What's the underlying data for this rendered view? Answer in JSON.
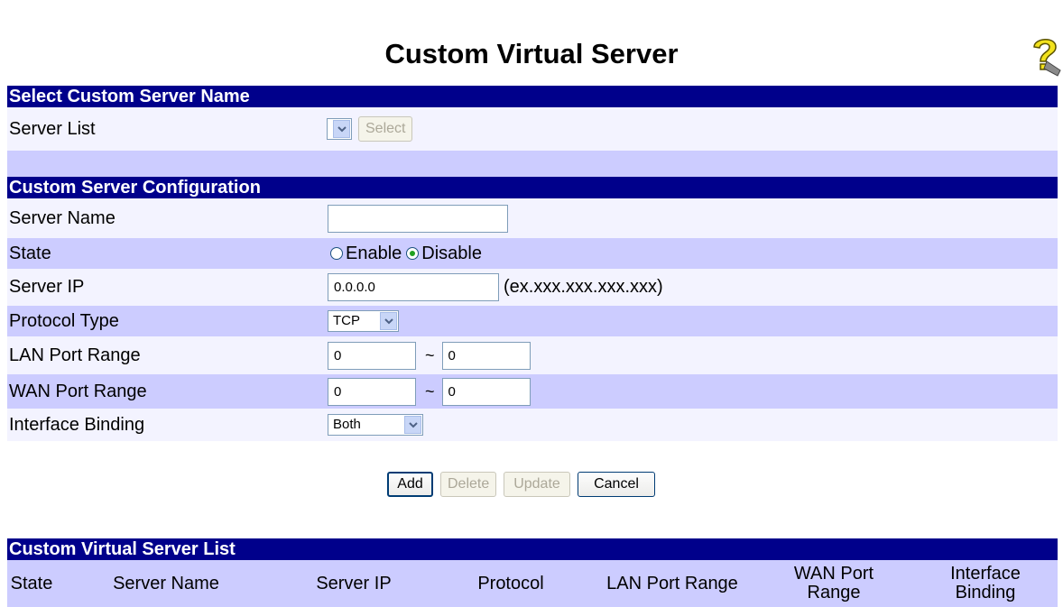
{
  "page": {
    "title": "Custom Virtual Server"
  },
  "select_section": {
    "header": "Select Custom Server Name",
    "server_list_label": "Server List",
    "server_list_value": "",
    "select_button": "Select"
  },
  "config_section": {
    "header": "Custom Server Configuration",
    "server_name_label": "Server Name",
    "server_name_value": "",
    "state_label": "State",
    "state_options": [
      "Enable",
      "Disable"
    ],
    "state_selected": "Disable",
    "server_ip_label": "Server IP",
    "server_ip_value": "0.0.0.0",
    "server_ip_hint": "(ex.xxx.xxx.xxx.xxx)",
    "protocol_label": "Protocol Type",
    "protocol_value": "TCP",
    "lan_port_label": "LAN Port Range",
    "lan_port_start": "0",
    "lan_port_end": "0",
    "wan_port_label": "WAN Port Range",
    "wan_port_start": "0",
    "wan_port_end": "0",
    "range_separator": "~",
    "interface_label": "Interface Binding",
    "interface_value": "Both"
  },
  "actions": {
    "add": "Add",
    "delete": "Delete",
    "update": "Update",
    "cancel": "Cancel"
  },
  "list_section": {
    "header": "Custom Virtual Server List",
    "columns": [
      "State",
      "Server Name",
      "Server IP",
      "Protocol",
      "LAN Port Range",
      "WAN Port Range",
      "Interface Binding"
    ]
  },
  "colors": {
    "header_bg": "#00008b",
    "row_light": "#f3f3ff",
    "row_dark": "#ccccff",
    "radio_dot": "#21a121"
  },
  "icons": {
    "help": "help-question-icon",
    "dropdown": "chevron-down-icon"
  }
}
